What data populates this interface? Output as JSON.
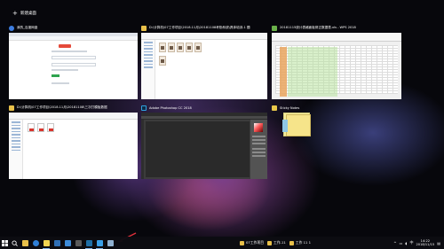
{
  "header": {
    "new_desktop_label": "新建桌面"
  },
  "windows": [
    {
      "title": "我的_百度网盘",
      "icon": "browser-icon",
      "color": "#3d7de0"
    },
    {
      "title": "D:\\计算机\\07工作项目\\2018.11月\\20181108考勤系统\\具体培训-1 题",
      "icon": "folder-icon",
      "color": "#e8c04a"
    },
    {
      "title": "20181115统计表格面板修正数据表.xls - WPS 2018",
      "icon": "spreadsheet-icon",
      "color": "#6ab04a"
    },
    {
      "title": "D:\\计算机\\07工作项目\\2018.11月\\20181108\\三次打模板数据",
      "icon": "folder-icon",
      "color": "#e8c04a"
    },
    {
      "title": "Adobe Photoshop CC 2018",
      "icon": "photoshop-icon",
      "color": "#2fa3e0"
    },
    {
      "title": "Sticky Notes",
      "icon": "sticky-notes-icon",
      "color": "#e8c84a"
    }
  ],
  "taskbar": {
    "pinned": [
      {
        "name": "file-explorer",
        "color": "#e8c04a"
      },
      {
        "name": "edge",
        "color": "#2f7fd6"
      },
      {
        "name": "sticky-notes",
        "color": "#f1d552"
      },
      {
        "name": "photos",
        "color": "#2f6fb6"
      },
      {
        "name": "store",
        "color": "#3d8bd8"
      },
      {
        "name": "calculator",
        "color": "#5a5a5a"
      },
      {
        "name": "photoshop",
        "color": "#1f6fa6"
      },
      {
        "name": "wps",
        "color": "#3aa0e8"
      },
      {
        "name": "task-view",
        "color": "#8fb0d0"
      }
    ],
    "tasks": [
      {
        "label": "07工作项目",
        "color": "#e8c04a"
      },
      {
        "label": "工作-11",
        "color": "#e8c04a"
      },
      {
        "label": "工作 11 1",
        "color": "#e8c04a"
      }
    ],
    "clock": {
      "time": "14:22",
      "date": "2018/11/15"
    }
  }
}
